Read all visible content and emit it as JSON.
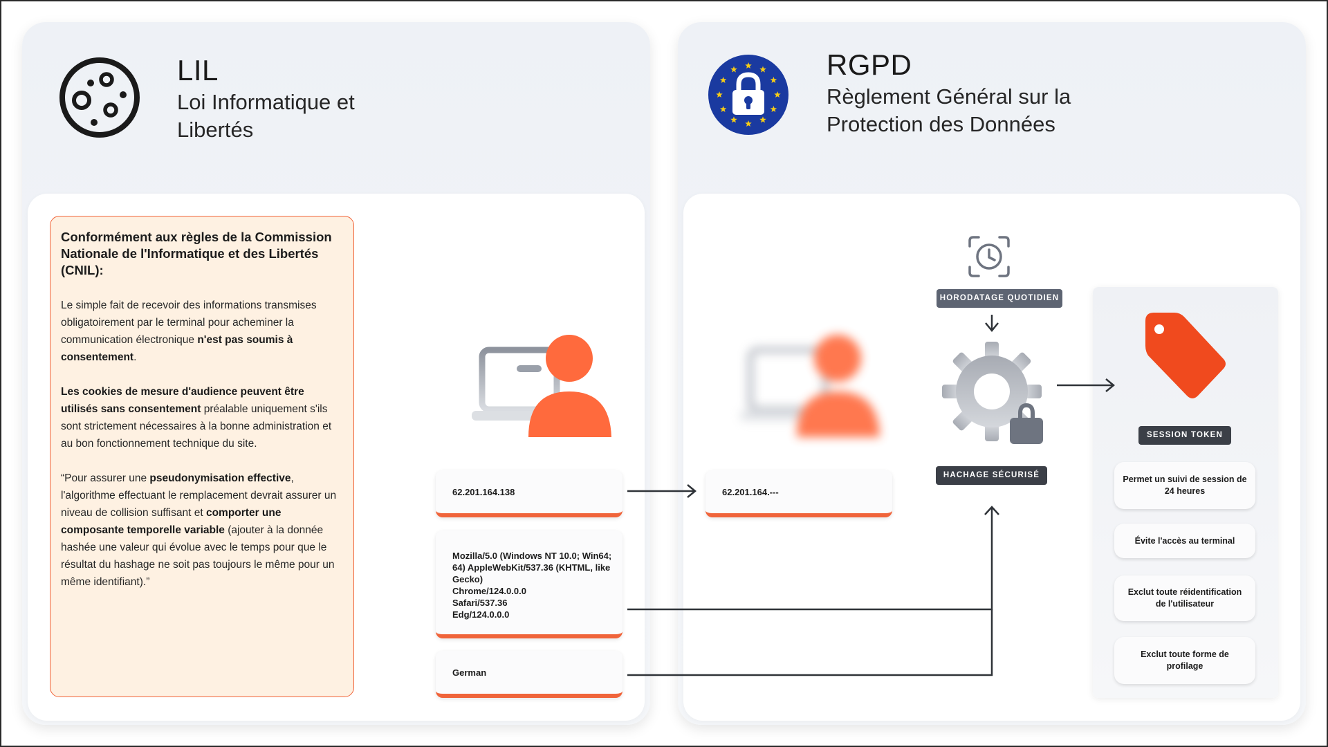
{
  "colors": {
    "accent": "#f0643a",
    "badge": "#5d6472",
    "badge_dark": "#3b3f47",
    "eu_blue": "#1a3aa0",
    "eu_star": "#f6cc16"
  },
  "lil": {
    "icon": "cookie-icon",
    "abbr": "LIL",
    "full_line1": "Loi Informatique et",
    "full_line2": "Libertés",
    "cnil": {
      "heading": "Conformément aux règles de la Commission Nationale de l'Informatique et des Libertés (CNIL):",
      "p1_text": "Le simple fait de recevoir des informations transmises obligatoirement par le terminal pour acheminer la communication électronique ",
      "p1_bold": "n'est pas soumis à consentement",
      "p1_end": ".",
      "p2_bold": "Les cookies de mesure d'audience peuvent être utilisés sans consentement",
      "p2_text": " préalable uniquement s'ils sont strictement nécessaires à la bonne administration et au bon fonctionnement technique du site.",
      "p3_a": "“Pour assurer une ",
      "p3_b": "pseudonymisation effective",
      "p3_c": ", l'algorithme effectuant le remplacement devrait assurer un niveau de collision suffisant et ",
      "p3_d": "comporter une composante temporelle variable",
      "p3_e": " (ajouter à la donnée hashée une valeur qui évolue avec le temps pour que le résultat du hashage ne soit pas toujours le même pour un même identifiant).”"
    },
    "user_icon": "user-laptop-icon",
    "cards": {
      "ip": "62.201.164.138",
      "ua_lines": [
        "Mozilla/5.0 (Windows NT 10.0; Win64;",
        "64) AppleWebKit/537.36 (KHTML, like",
        "Gecko)",
        "Chrome/124.0.0.0",
        "Safari/537.36",
        "Edg/124.0.0.0"
      ],
      "lang": "German"
    }
  },
  "rgpd": {
    "icon": "eu-lock-icon",
    "abbr": "RGPD",
    "full_line1": "Règlement Général sur la",
    "full_line2": "Protection des Données",
    "ip_masked": "62.201.164.---",
    "badge_time": "HORODATAGE QUOTIDIEN",
    "badge_hash": "HACHAGE SÉCURISÉ",
    "badge_token": "SESSION TOKEN",
    "time_icon": "clock-scan-icon",
    "hash_icon": "gear-lock-icon",
    "token_icon": "tag-icon",
    "features": [
      "Permet un suivi de session de 24 heures",
      "Évite l'accès au terminal",
      "Exclut toute réidentification de l'utilisateur",
      "Exclut toute forme de profilage"
    ]
  }
}
